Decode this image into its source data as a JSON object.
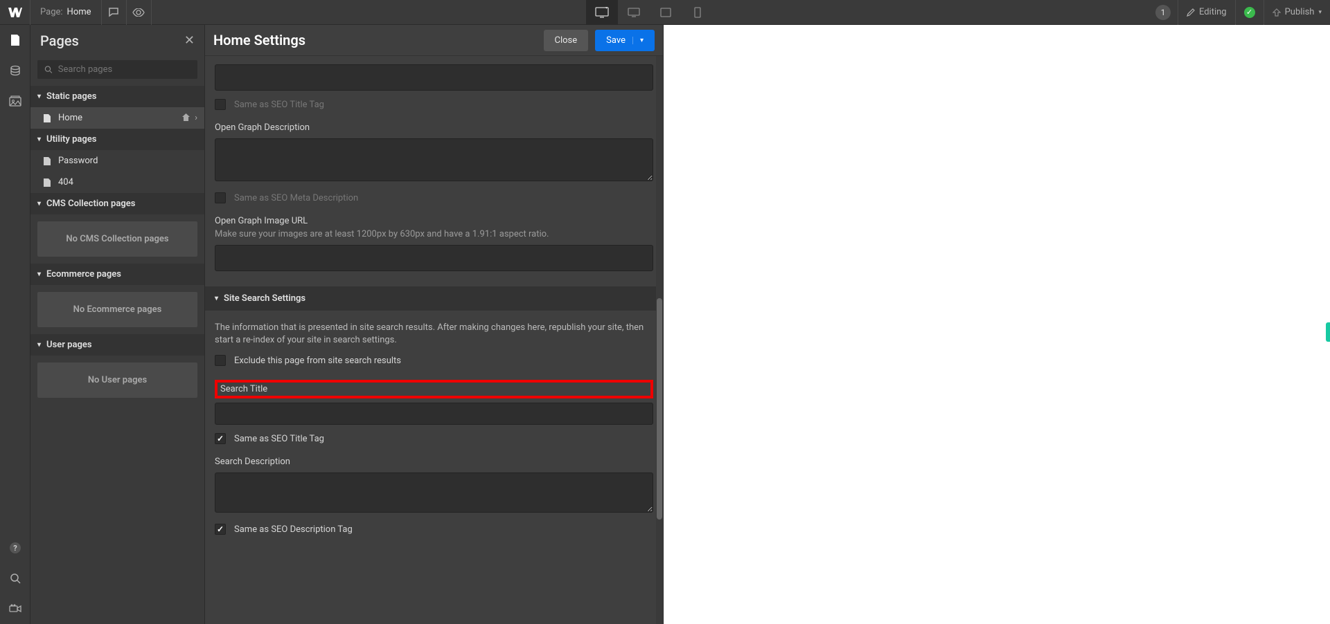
{
  "topbar": {
    "page_label": "Page:",
    "page_name": "Home",
    "editing_label": "Editing",
    "publish_label": "Publish",
    "notif_count": "1"
  },
  "pages_panel": {
    "title": "Pages",
    "search_placeholder": "Search pages",
    "sections": {
      "static": {
        "header": "Static pages",
        "items": [
          "Home"
        ]
      },
      "utility": {
        "header": "Utility pages",
        "items": [
          "Password",
          "404"
        ]
      },
      "cms": {
        "header": "CMS Collection pages",
        "empty": "No CMS Collection pages"
      },
      "ecommerce": {
        "header": "Ecommerce pages",
        "empty": "No Ecommerce pages"
      },
      "user": {
        "header": "User pages",
        "empty": "No User pages"
      }
    }
  },
  "settings": {
    "title": "Home Settings",
    "close": "Close",
    "save": "Save",
    "og_title_same": "Same as SEO Title Tag",
    "og_desc_label": "Open Graph Description",
    "og_desc_same": "Same as SEO Meta Description",
    "og_image_label": "Open Graph Image URL",
    "og_image_hint": "Make sure your images are at least 1200px by 630px and have a 1.91:1 aspect ratio.",
    "site_search_header": "Site Search Settings",
    "site_search_info": "The information that is presented in site search results. After making changes here, republish your site, then start a re-index of your site in search settings.",
    "exclude_label": "Exclude this page from site search results",
    "search_title_label": "Search Title",
    "search_title_same": "Same as SEO Title Tag",
    "search_desc_label": "Search Description",
    "search_desc_same": "Same as SEO Description Tag"
  }
}
